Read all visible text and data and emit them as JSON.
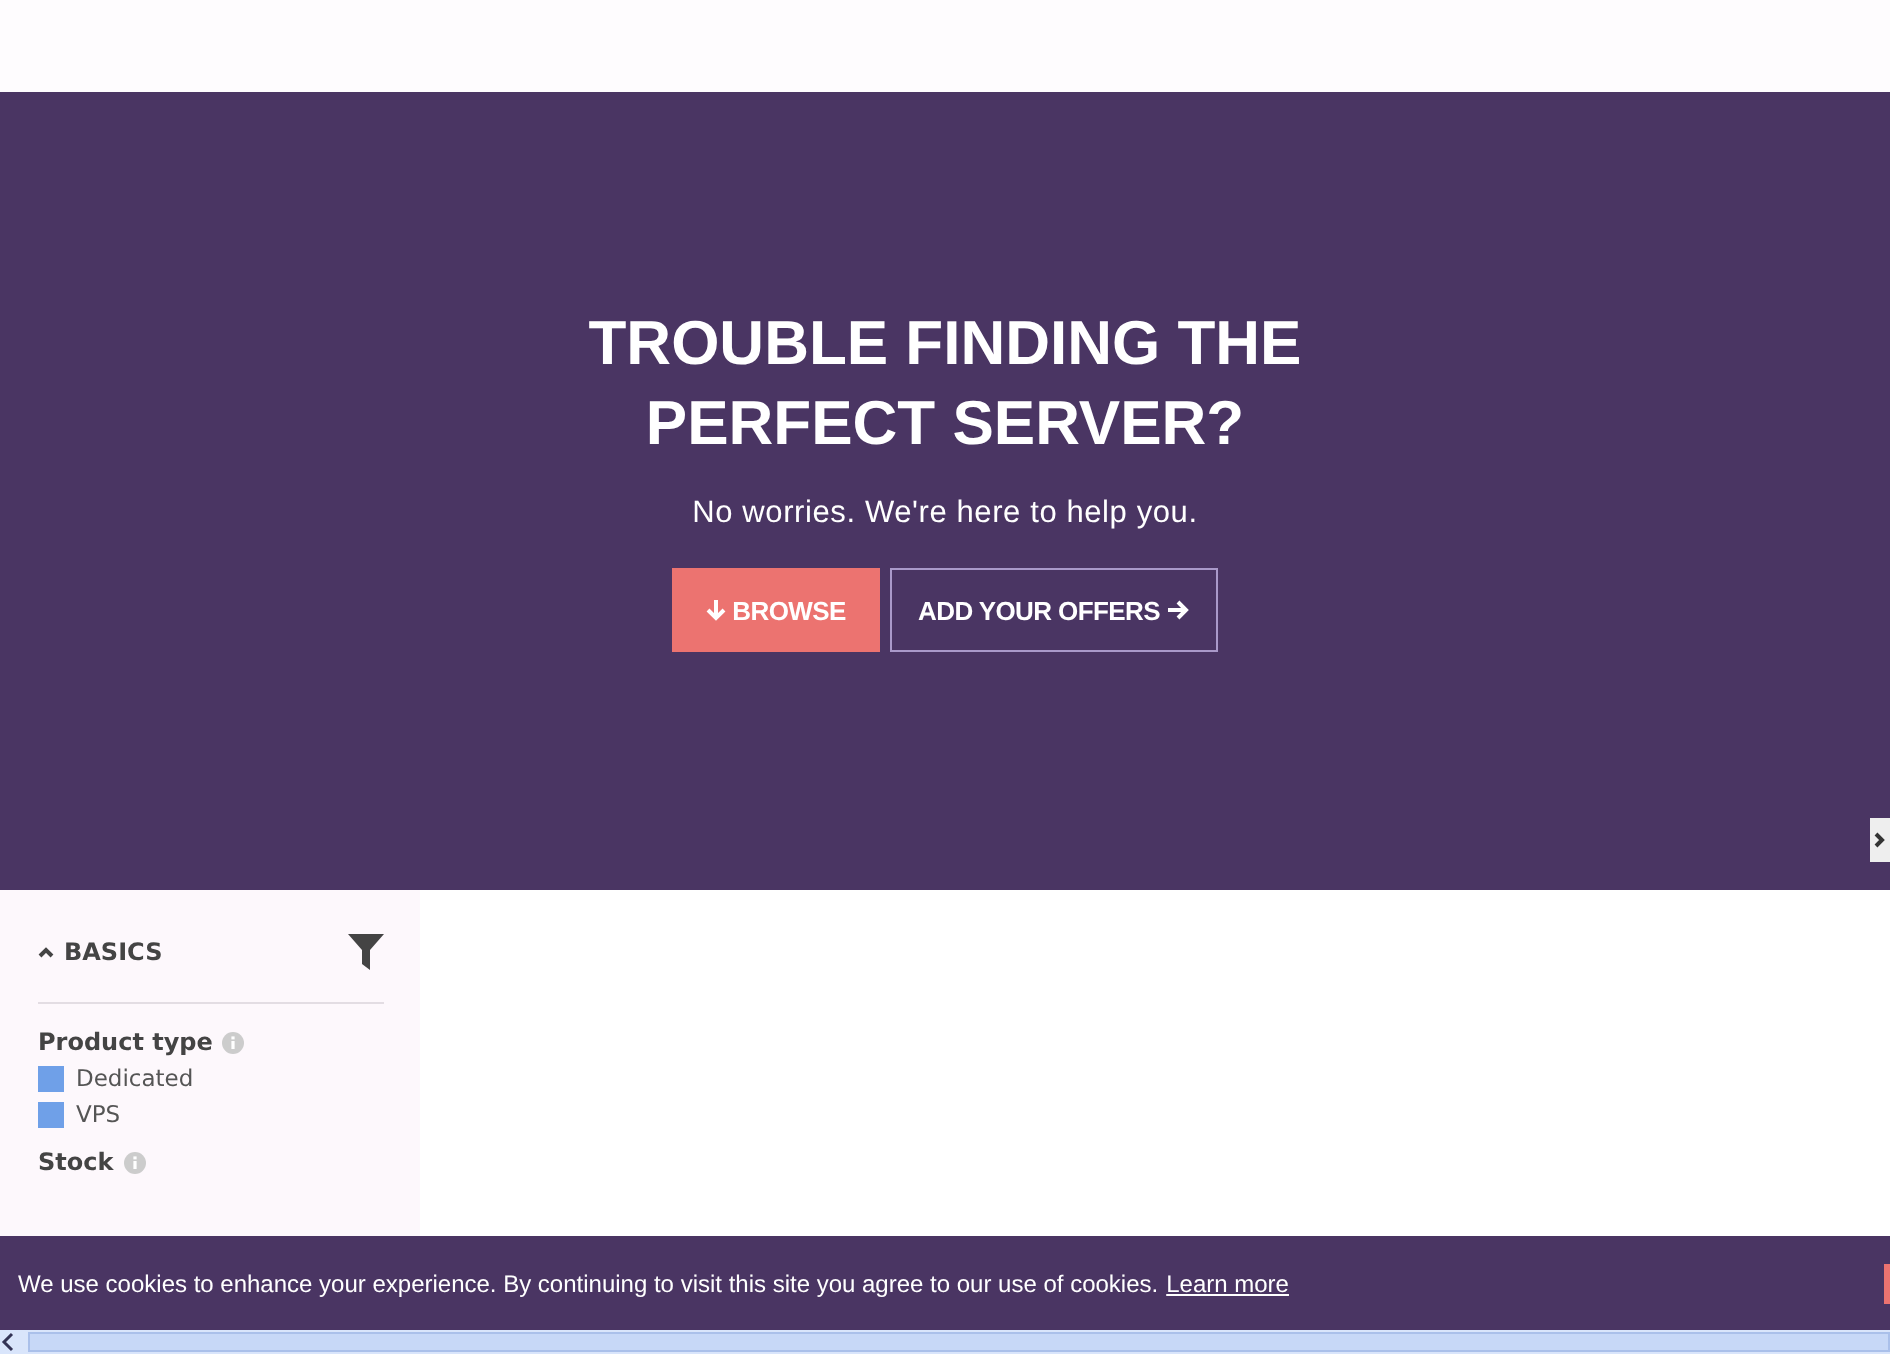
{
  "hero": {
    "title": "TROUBLE FINDING THE PERFECT SERVER?",
    "subtitle": "No worries. We're here to help you.",
    "buttons": [
      {
        "kind": "primary",
        "label": "BROWSE"
      },
      {
        "kind": "outline",
        "label": "ADD YOUR OFFERS"
      }
    ]
  },
  "sidebar": {
    "section": {
      "label": "BASICS",
      "expanded": true
    },
    "filters": [
      {
        "label": "Product type",
        "options": [
          {
            "label": "Dedicated",
            "checked": true
          },
          {
            "label": "VPS",
            "checked": true
          }
        ]
      },
      {
        "label": "Stock"
      }
    ]
  },
  "cookie_bar": {
    "text": "We use cookies to enhance your experience. By continuing to visit this site you agree to our use of cookies.",
    "link": "Learn more"
  }
}
